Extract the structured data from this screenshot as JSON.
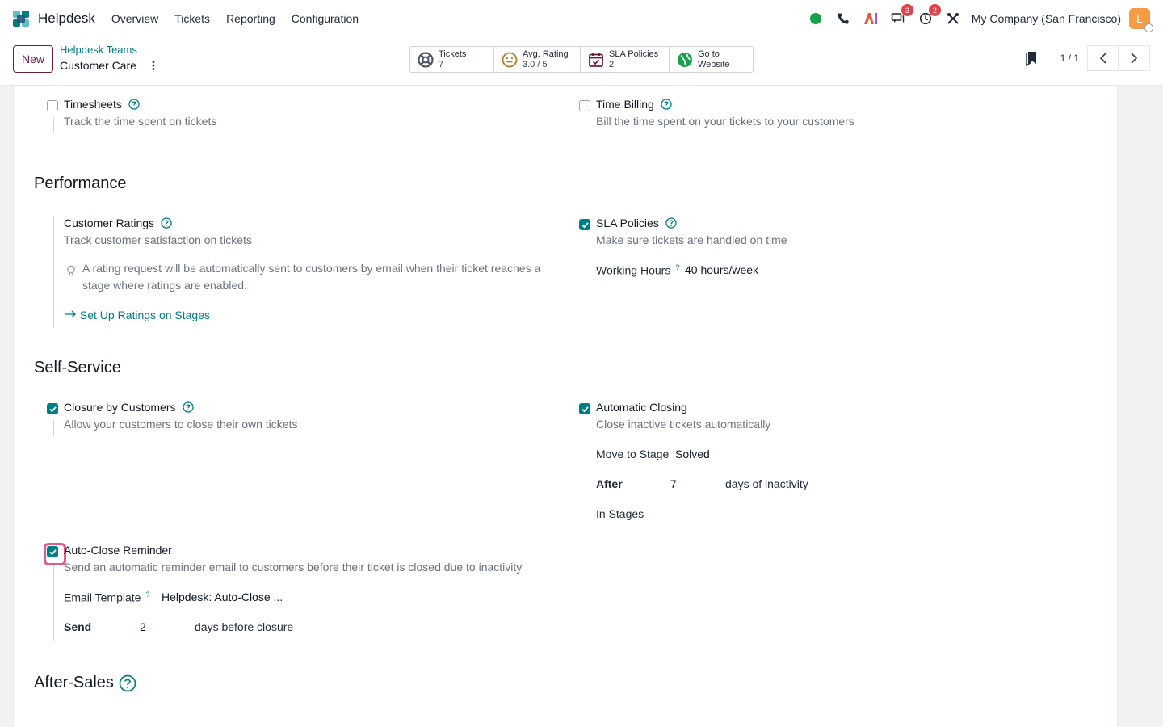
{
  "app": {
    "name": "Helpdesk",
    "menu": [
      "Overview",
      "Tickets",
      "Reporting",
      "Configuration"
    ],
    "company": "My Company (San Francisco)",
    "avatar_letter": "L",
    "messages_badge": "3",
    "activities_badge": "2"
  },
  "control": {
    "new_label": "New",
    "breadcrumb_parent": "Helpdesk Teams",
    "breadcrumb_current": "Customer Care",
    "stats": [
      {
        "label": "Tickets",
        "value": "7",
        "icon": "lifebuoy-icon"
      },
      {
        "label": "Avg. Rating",
        "value": "3.0 / 5",
        "icon": "smiley-icon"
      },
      {
        "label": "SLA Policies",
        "value": "2",
        "icon": "calendar-check-icon"
      },
      {
        "label": "Go to",
        "value": "Website",
        "icon": "globe-icon"
      }
    ],
    "pager": "1 / 1"
  },
  "settings": {
    "timesheets": {
      "title": "Timesheets",
      "desc": "Track the time spent on tickets",
      "checked": false
    },
    "time_billing": {
      "title": "Time Billing",
      "desc": "Bill the time spent on your tickets to your customers",
      "checked": false
    },
    "performance_title": "Performance",
    "customer_ratings": {
      "title": "Customer Ratings",
      "desc": "Track customer satisfaction on tickets",
      "tip": "A rating request will be automatically sent to customers by email when their ticket reaches a stage where ratings are enabled.",
      "link": "Set Up Ratings on Stages",
      "checked": false
    },
    "sla_policies": {
      "title": "SLA Policies",
      "desc": "Make sure tickets are handled on time",
      "working_hours_label": "Working Hours",
      "working_hours_value": "40 hours/week",
      "checked": true
    },
    "self_service_title": "Self-Service",
    "closure": {
      "title": "Closure by Customers",
      "desc": "Allow your customers to close their own tickets",
      "checked": true
    },
    "auto_closing": {
      "title": "Automatic Closing",
      "desc": "Close inactive tickets automatically",
      "move_label": "Move to Stage",
      "move_value": "Solved",
      "after_label": "After",
      "after_value": "7",
      "after_suffix": "days of inactivity",
      "stages_label": "In Stages",
      "checked": true
    },
    "auto_close_reminder": {
      "title": "Auto-Close Reminder",
      "desc": "Send an automatic reminder email to customers before their ticket is closed due to inactivity",
      "template_label": "Email Template",
      "template_value": "Helpdesk: Auto-Close ...",
      "send_label": "Send",
      "send_value": "2",
      "send_suffix": "days before closure",
      "checked": true
    },
    "after_sales_title": "After-Sales"
  },
  "colors": {
    "accent": "#017e84",
    "brand": "#6b1f3a",
    "focus": "#e0598b"
  }
}
